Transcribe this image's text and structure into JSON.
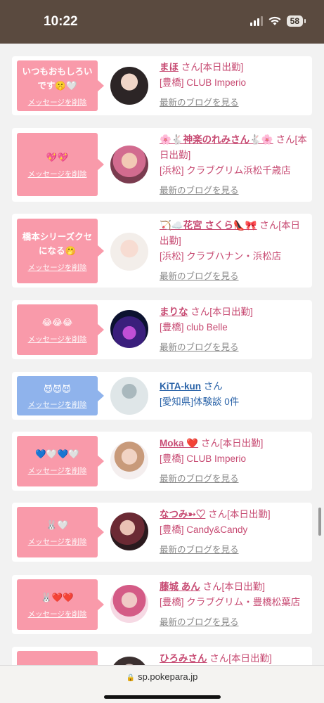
{
  "status": {
    "time": "10:22",
    "battery": "58"
  },
  "browser": {
    "url": "sp.pokepara.jp"
  },
  "cards": [
    {
      "message": "いつもおもしろいです🤫🤍",
      "delete_label": "メッセージを削除",
      "name": "まほ",
      "suffix": "さん[本日出勤]",
      "location": "[豊橋] CLUB Imperio",
      "blog": "最新のブログを見る",
      "bubble_color": "#f99aaa"
    },
    {
      "message": "💖💖",
      "delete_label": "メッセージを削除",
      "name": "🌸🐇神楽のれみさん🐇🌸",
      "suffix": "さん[本日出勤]",
      "location": "[浜松] クラブグリム浜松千歳店",
      "blog": "最新のブログを見る",
      "bubble_color": "#f99aaa"
    },
    {
      "message": "橋本シリーズクセになる🤭",
      "delete_label": "メッセージを削除",
      "name": "🏹☁️花宮 さくら👠🎀",
      "suffix": "さん[本日出勤]",
      "location": "[浜松] クラブハナン・浜松店",
      "blog": "最新のブログを見る",
      "bubble_color": "#f99aaa"
    },
    {
      "message": "😂😂😂",
      "delete_label": "メッセージを削除",
      "name": "まりな",
      "suffix": "さん[本日出勤]",
      "location": "[豊橋] club Belle",
      "blog": "最新のブログを見る",
      "bubble_color": "#f99aaa"
    },
    {
      "message": "😈😈😈",
      "delete_label": "メッセージを削除",
      "name": "KiTA-kun",
      "suffix": "さん",
      "location": "[愛知県]体験談 0件",
      "blog": "",
      "bubble_color": "#8fb3ec"
    },
    {
      "message": "💙🤍💙🤍",
      "delete_label": "メッセージを削除",
      "name": "Moka ❤️",
      "suffix": "さん[本日出勤]",
      "location": "[豊橋] CLUB Imperio",
      "blog": "最新のブログを見る",
      "bubble_color": "#f99aaa"
    },
    {
      "message": "🐰🤍",
      "delete_label": "メッセージを削除",
      "name": "なつみ➳♡",
      "suffix": "さん[本日出勤]",
      "location": "[豊橋] Candy&Candy",
      "blog": "最新のブログを見る",
      "bubble_color": "#f99aaa"
    },
    {
      "message": "🐰❤️❤️",
      "delete_label": "メッセージを削除",
      "name": "藤城 あん",
      "suffix": "さん[本日出勤]",
      "location": "[豊橋] クラブグリム・豊橋松葉店",
      "blog": "最新のブログを見る",
      "bubble_color": "#f99aaa"
    },
    {
      "message": "",
      "delete_label": "",
      "name": "ひろみさん",
      "suffix": "さん[本日出勤]",
      "location": "",
      "blog": "",
      "bubble_color": "#f99aaa"
    }
  ]
}
